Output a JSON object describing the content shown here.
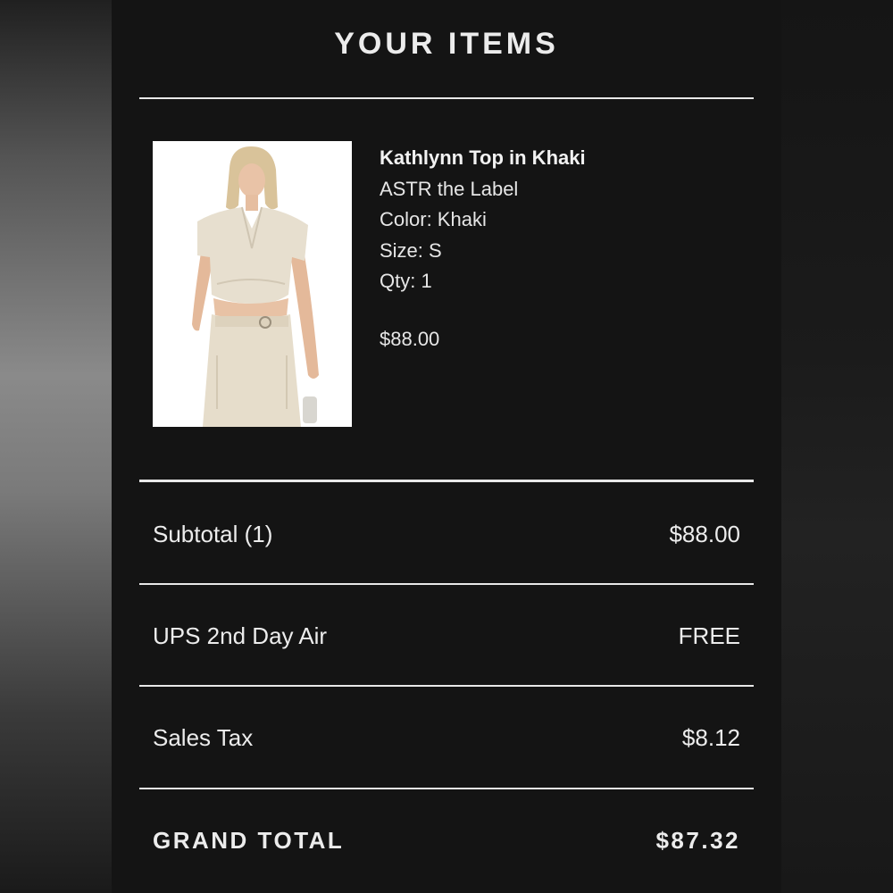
{
  "header": {
    "title": "YOUR ITEMS"
  },
  "item": {
    "name": "Kathlynn Top in Khaki",
    "brand": "ASTR the Label",
    "color": "Color: Khaki",
    "size": "Size: S",
    "qty": "Qty: 1",
    "price": "$88.00"
  },
  "summary": {
    "subtotal_label": "Subtotal (1)",
    "subtotal_value": "$88.00",
    "shipping_label": "UPS 2nd Day Air",
    "shipping_value": "FREE",
    "tax_label": "Sales Tax",
    "tax_value": "$8.12",
    "grand_total_label": "GRAND TOTAL",
    "grand_total_value": "$87.32"
  },
  "colors": {
    "panel_background": "#141414",
    "text": "#ececec",
    "divider": "#e8e8e8"
  }
}
